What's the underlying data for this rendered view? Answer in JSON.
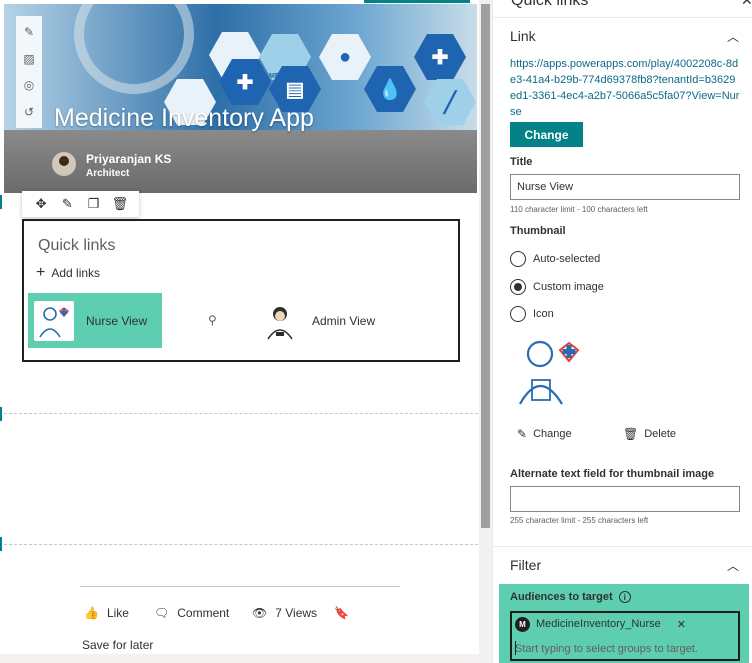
{
  "hero": {
    "title": "Medicine Inventory App",
    "author_name": "Priyaranjan KS",
    "author_role": "Architect",
    "hex_labels": [
      "MEDICAL"
    ]
  },
  "quick_links": {
    "title": "Quick links",
    "add_links_label": "Add links",
    "items": [
      {
        "label": "Nurse View",
        "icon": "nurse-thumbnail"
      },
      {
        "label": "Admin View",
        "icon": "admin-thumbnail"
      }
    ]
  },
  "social": {
    "like_label": "Like",
    "comment_label": "Comment",
    "views_label": "7 Views",
    "save_later_label": "Save for later"
  },
  "pane": {
    "title": "Quick links",
    "link_group_title": "Link",
    "url": "https://apps.powerapps.com/play/4002208c-8de3-41a4-b29b-774d69378fb8?tenantId=b3629ed1-3361-4ec4-a2b7-5066a5c5fa07?View=Nurse",
    "change_button": "Change",
    "title_label": "Title",
    "title_value": "Nurse View",
    "title_hint": "110 character limit - 100 characters left",
    "thumbnail_label": "Thumbnail",
    "thumbnail_options": [
      "Auto-selected",
      "Custom image",
      "Icon"
    ],
    "thumbnail_selected": "Custom image",
    "thumb_change_label": "Change",
    "thumb_delete_label": "Delete",
    "alt_label": "Alternate text field for thumbnail image",
    "alt_value": "",
    "alt_hint": "255 character limit - 255 characters left",
    "filter_group_title": "Filter",
    "audiences_label": "Audiences to target",
    "audience_chip": "MedicineInventory_Nurse",
    "audience_chip_initial": "M",
    "audience_placeholder": "Start typing to select groups to target."
  },
  "colors": {
    "accent": "#038387",
    "highlight": "#5dcfb0",
    "link": "#0b6a8a"
  }
}
